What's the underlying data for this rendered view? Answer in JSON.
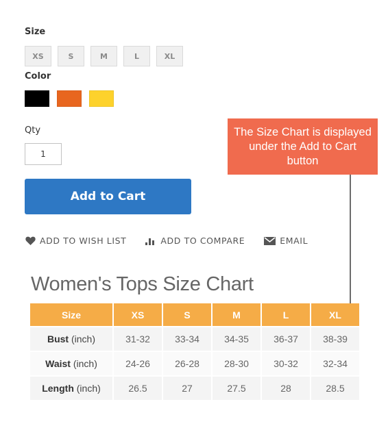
{
  "product_options": {
    "size": {
      "label": "Size",
      "options": [
        "XS",
        "S",
        "M",
        "L",
        "XL"
      ]
    },
    "color": {
      "label": "Color",
      "options": [
        {
          "name": "black",
          "hex": "#000000"
        },
        {
          "name": "orange",
          "hex": "#e8661f"
        },
        {
          "name": "yellow",
          "hex": "#fdd22c"
        }
      ]
    },
    "qty": {
      "label": "Qty",
      "value": "1"
    }
  },
  "add_to_cart": {
    "label": "Add to Cart",
    "color": "#2e78c4"
  },
  "actions": [
    {
      "icon": "heart-icon",
      "label": "ADD TO WISH LIST"
    },
    {
      "icon": "bar-chart-icon",
      "label": "ADD TO COMPARE"
    },
    {
      "icon": "envelope-icon",
      "label": "EMAIL"
    }
  ],
  "callout": {
    "text": "The Size Chart is displayed under the Add to Cart button",
    "color": "#f06b4e"
  },
  "size_chart": {
    "title": "Women's Tops Size Chart",
    "header_color": "#f5ac47",
    "headers": [
      "Size",
      "XS",
      "S",
      "M",
      "L",
      "XL"
    ],
    "rows": [
      {
        "measure": "Bust",
        "unit": "(inch)",
        "values": [
          "31-32",
          "33-34",
          "34-35",
          "36-37",
          "38-39"
        ]
      },
      {
        "measure": "Waist",
        "unit": "(inch)",
        "values": [
          "24-26",
          "26-28",
          "28-30",
          "30-32",
          "32-34"
        ]
      },
      {
        "measure": "Length",
        "unit": "(inch)",
        "values": [
          "26.5",
          "27",
          "27.5",
          "28",
          "28.5"
        ]
      }
    ]
  }
}
